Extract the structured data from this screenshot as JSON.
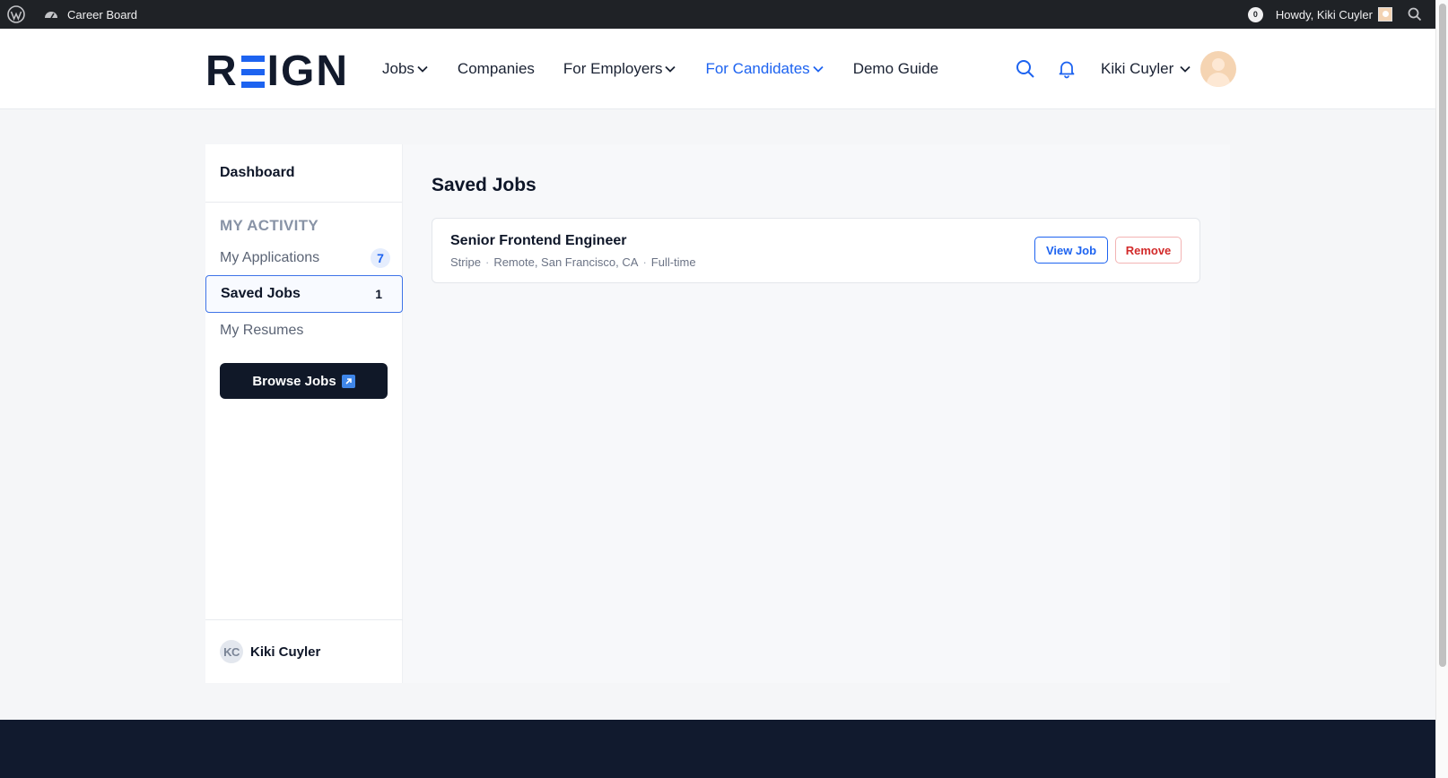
{
  "admin_bar": {
    "site_name": "Career Board",
    "notification_count": "0",
    "howdy": "Howdy, Kiki Cuyler"
  },
  "header": {
    "logo_text": "REIGN",
    "nav": [
      {
        "label": "Jobs",
        "has_dropdown": true
      },
      {
        "label": "Companies",
        "has_dropdown": false
      },
      {
        "label": "For Employers",
        "has_dropdown": true
      },
      {
        "label": "For Candidates",
        "has_dropdown": true,
        "active": true
      },
      {
        "label": "Demo Guide",
        "has_dropdown": false
      }
    ],
    "user_name": "Kiki Cuyler"
  },
  "sidebar": {
    "dashboard": "Dashboard",
    "section_title": "MY ACTIVITY",
    "items": [
      {
        "label": "My Applications",
        "count": "7"
      },
      {
        "label": "Saved Jobs",
        "count": "1",
        "active": true
      },
      {
        "label": "My Resumes"
      }
    ],
    "browse_button": "Browse Jobs",
    "footer_initials": "KC",
    "footer_name": "Kiki Cuyler"
  },
  "main": {
    "title": "Saved Jobs",
    "jobs": [
      {
        "title": "Senior Frontend Engineer",
        "company": "Stripe",
        "location": "Remote, San Francisco, CA",
        "type": "Full-time",
        "view_label": "View Job",
        "remove_label": "Remove"
      }
    ]
  },
  "colors": {
    "accent": "#1d63f0",
    "dark": "#101828",
    "danger": "#d22a2a",
    "admin_bar": "#1f2226",
    "footer": "#111a2e"
  },
  "icons": [
    "wordpress-icon",
    "dashboard-icon",
    "search-icon",
    "bell-icon",
    "chevron-down-icon",
    "external-link-icon"
  ]
}
